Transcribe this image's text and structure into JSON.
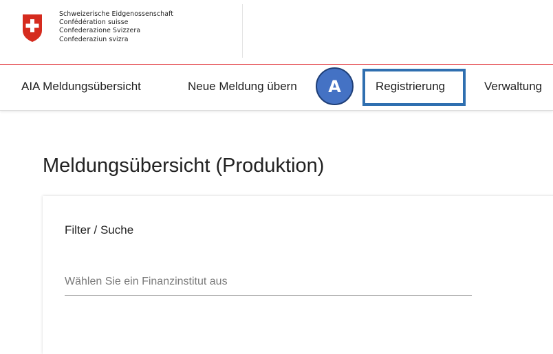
{
  "brand": {
    "lines": [
      "Schweizerische Eidgenossenschaft",
      "Confédération suisse",
      "Confederazione Svizzera",
      "Confederaziun svizra"
    ],
    "crest_color": "#d52b1e"
  },
  "nav": {
    "items": [
      {
        "label": "AIA Meldungsübersicht"
      },
      {
        "label": "Neue Meldung übern"
      },
      {
        "label": "Registrierung"
      },
      {
        "label": "Verwaltung"
      }
    ],
    "highlighted_item": "Registrierung",
    "highlight_color": "#2f6fb0"
  },
  "annotation": {
    "badge_label": "A",
    "badge_color": "#4472c4"
  },
  "main": {
    "title": "Meldungsübersicht (Produktion)",
    "filter": {
      "title": "Filter / Suche",
      "placeholder": "Wählen Sie ein Finanzinstitut aus"
    }
  },
  "colors": {
    "accent_rule": "#e0282e"
  }
}
